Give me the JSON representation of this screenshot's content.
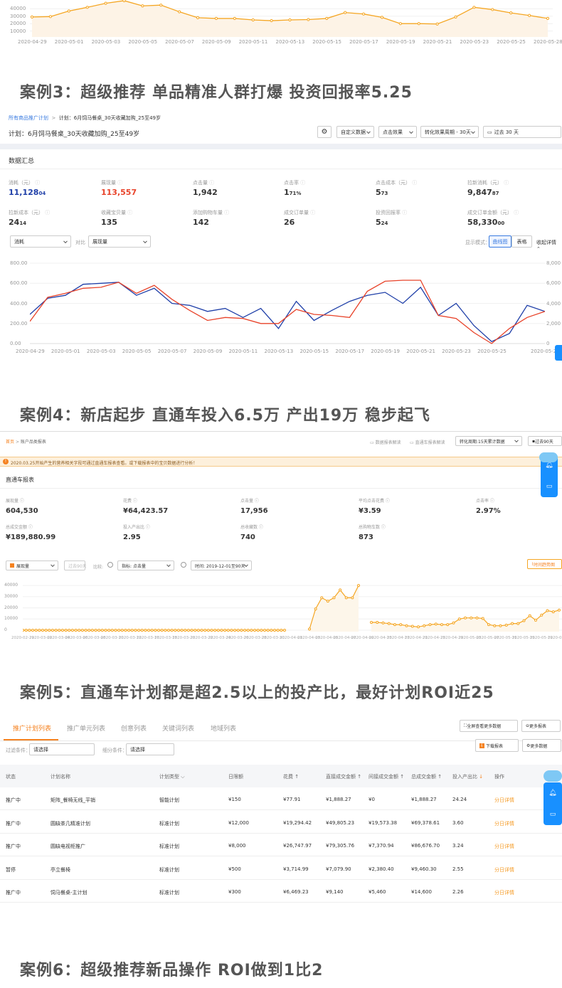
{
  "top_chart": {
    "y_ticks": [
      "40000",
      "30000",
      "20000",
      "10000"
    ],
    "x_ticks": [
      "2020-04-29",
      "2020-05-01",
      "2020-05-03",
      "2020-05-05",
      "2020-05-07",
      "2020-05-09",
      "2020-05-11",
      "2020-05-13",
      "2020-05-15",
      "2020-05-17",
      "2020-05-19",
      "2020-05-21",
      "2020-05-23",
      "2020-05-25",
      "2020-05-28"
    ],
    "series": [
      29000,
      29500,
      37000,
      42000,
      47500,
      51000,
      44000,
      45000,
      36000,
      28000,
      27000,
      27000,
      25000,
      24000,
      25000,
      25500,
      27000,
      35000,
      33000,
      28500,
      20000,
      20000,
      19500,
      29000,
      42000,
      39000,
      34500,
      31000,
      27000
    ]
  },
  "case3": {
    "title": "案例3：超级推荐 单品精准人群打爆 投资回报率5.25",
    "breadcrumb_link": "所有商品推广计划",
    "breadcrumb_current": "计划：6月饲马餐桌_30天收藏加购_25至49岁",
    "plan_title": "计划：6月饲马餐桌_30天收藏加购_25至49岁",
    "toolbar": {
      "custom_data": "自定义数据",
      "click_effect": "点击效果",
      "conversion_period": "转化效果周期 - 30天",
      "date_range": "过去 30 天"
    },
    "summary_title": "数据汇总",
    "metrics": [
      {
        "label": "消耗（元）",
        "main": "11,128",
        "dec": "04"
      },
      {
        "label": "展现量",
        "main": "113,557",
        "dec": ""
      },
      {
        "label": "点击量",
        "main": "1,942",
        "dec": ""
      },
      {
        "label": "点击率",
        "main": "1",
        "dec": "71%"
      },
      {
        "label": "点击成本（元）",
        "main": "5",
        "dec": "73"
      },
      {
        "label": "拉新消耗（元）",
        "main": "9,847",
        "dec": "87"
      },
      {
        "label": "拉新成本（元）",
        "main": "24",
        "dec": "14"
      },
      {
        "label": "收藏宝贝量",
        "main": "135",
        "dec": ""
      },
      {
        "label": "添加购物车量",
        "main": "142",
        "dec": ""
      },
      {
        "label": "成交订单量",
        "main": "26",
        "dec": ""
      },
      {
        "label": "投资回报率",
        "main": "5",
        "dec": "24"
      },
      {
        "label": "成交订单金额（元）",
        "main": "58,330",
        "dec": "00"
      }
    ],
    "select_left": "消耗",
    "compare_label": "对比",
    "select_right": "展现量",
    "display_mode_label": "显示模式：",
    "mode_curve": "曲线图",
    "mode_table": "表格",
    "collapse": "收起详情",
    "chart_data": {
      "type": "line",
      "x": [
        "2020-04-29",
        "2020-04-30",
        "2020-05-01",
        "2020-05-02",
        "2020-05-03",
        "2020-05-04",
        "2020-05-05",
        "2020-05-06",
        "2020-05-07",
        "2020-05-08",
        "2020-05-09",
        "2020-05-10",
        "2020-05-11",
        "2020-05-12",
        "2020-05-13",
        "2020-05-14",
        "2020-05-15",
        "2020-05-16",
        "2020-05-17",
        "2020-05-18",
        "2020-05-19",
        "2020-05-20",
        "2020-05-21",
        "2020-05-22",
        "2020-05-23",
        "2020-05-24",
        "2020-05-25",
        "2020-05-26",
        "2020-05-27",
        "2020-05-28"
      ],
      "x_ticks": [
        "2020-04-29",
        "2020-05-01",
        "2020-05-03",
        "2020-05-05",
        "2020-05-07",
        "2020-05-09",
        "2020-05-11",
        "2020-05-13",
        "2020-05-15",
        "2020-05-17",
        "2020-05-19",
        "2020-05-21",
        "2020-05-23",
        "2020-05-25",
        "2020-05-28"
      ],
      "y_left_ticks": [
        "800.00",
        "600.00",
        "400.00",
        "200.00",
        "0.00"
      ],
      "y_right_ticks": [
        "8,000",
        "6,000",
        "4,000",
        "2,000",
        "0"
      ],
      "ylim": [
        0,
        800
      ],
      "series": [
        {
          "name": "消耗",
          "color": "#1f3fa8",
          "values": [
            290,
            450,
            480,
            590,
            600,
            610,
            480,
            550,
            400,
            380,
            320,
            350,
            260,
            350,
            150,
            420,
            230,
            330,
            420,
            480,
            510,
            400,
            560,
            280,
            400,
            180,
            20,
            100,
            380,
            320
          ]
        },
        {
          "name": "展现量",
          "color": "#e8432a",
          "values": [
            220,
            460,
            500,
            550,
            560,
            610,
            500,
            580,
            440,
            330,
            230,
            260,
            250,
            200,
            200,
            340,
            290,
            280,
            260,
            520,
            620,
            630,
            630,
            280,
            250,
            110,
            0,
            150,
            260,
            320
          ]
        }
      ]
    }
  },
  "case4": {
    "title": "案例4：新店起步 直通车投入6.5万 产出19万 稳步起飞",
    "breadcrumb_home": "首页",
    "breadcrumb_current": "账户品类报表",
    "top_links": [
      "数据报表解读",
      "直通车报表解读"
    ],
    "conversion_select": "转化周期:15天累计数据",
    "date_btn": "过去90天",
    "notice": "2020.03.25开始产生的营养相关字段可通过直通车报表查看。或下载报表中的宝贝数据进行分析！",
    "report_title": "直通车报表",
    "metrics": [
      {
        "label": "展现量",
        "value": "604,530"
      },
      {
        "label": "花费",
        "value": "¥64,423.57"
      },
      {
        "label": "点击量",
        "value": "17,956"
      },
      {
        "label": "平均点击花费",
        "value": "¥3.59"
      },
      {
        "label": "点击率",
        "value": "2.97%"
      },
      {
        "label": "总成交金额",
        "value": "¥189,880.99"
      },
      {
        "label": "投入产出比",
        "value": "2.95"
      },
      {
        "label": "总收藏数",
        "value": "740"
      },
      {
        "label": "总购物车数",
        "value": "873"
      }
    ],
    "select_metric": "展现量",
    "past_btn": "过去90天",
    "compare_label": "比较:",
    "index_label": "指标:",
    "index_value": "点击量",
    "time_label": "时间:",
    "time_value": "2019-12-01至90天",
    "trend_btn": "时间趋势图",
    "chart_data": {
      "type": "line",
      "y_ticks": [
        "40000",
        "30000",
        "20000",
        "10000",
        "0"
      ],
      "x_ticks": [
        "2020-02-29",
        "2020-03-02",
        "2020-03-04",
        "2020-03-06",
        "2020-03-08",
        "2020-03-10",
        "2020-03-12",
        "2020-03-16",
        "2020-03-18",
        "2020-03-20",
        "2020-03-22",
        "2020-03-24",
        "2020-03-26",
        "2020-03-28",
        "2020-03-30",
        "2020-04-01",
        "2020-04-03",
        "2020-04-05",
        "2020-04-07",
        "2020-04-09",
        "2020-04-13",
        "2020-04-17",
        "2020-04-21",
        "2020-04-25",
        "2020-04-29",
        "2020-05-03",
        "2020-05-07",
        "2020-05-11",
        "2020-05-15",
        "2020-05-19",
        "2020-05-21"
      ],
      "color": "#f5a623",
      "segment1": [
        0,
        0,
        0,
        0,
        0,
        0,
        0,
        0,
        0,
        0,
        0,
        0,
        0,
        0,
        0,
        0,
        0,
        0,
        0,
        0,
        0,
        0,
        0,
        0,
        0,
        0,
        0,
        0,
        0,
        0,
        0,
        0,
        0,
        0,
        0,
        0,
        0,
        0,
        0,
        0,
        0,
        0,
        0,
        0,
        0,
        0,
        0,
        0,
        0,
        0,
        0,
        0,
        0,
        0,
        0,
        0,
        0,
        0,
        0,
        0,
        0,
        0,
        0,
        0,
        0,
        0,
        0,
        0,
        0,
        0,
        0,
        0,
        0,
        0,
        0,
        0,
        0,
        0,
        0,
        0
      ],
      "segment2": [
        1000,
        19000,
        29000,
        26000,
        29000,
        36000,
        29000,
        29000,
        40000
      ],
      "segment3": [
        7000,
        7000,
        6500,
        6000,
        5000,
        5000,
        4000,
        3500,
        3000,
        4000,
        5000,
        5500,
        5000,
        5000,
        6500,
        10000,
        11000,
        11000,
        11000,
        10500,
        5000,
        4000,
        4000,
        4500,
        6000,
        6000,
        8500,
        13000,
        9000,
        13500,
        17500,
        16500,
        18000
      ]
    }
  },
  "case5": {
    "title": "案例5：直通车计划都是超2.5以上的投产比，最好计划ROI近25",
    "tabs": [
      "推广计划列表",
      "推广单元列表",
      "创意列表",
      "关键词列表",
      "地域列表"
    ],
    "fullscreen_btn": "全屏查看更多数据",
    "more_btn": "更多报表",
    "filter_label": "过滤条件：",
    "filter_placeholder": "请选择",
    "sub_filter_label": "细分条件：",
    "sub_filter_placeholder": "请选择",
    "download_btn": "下载报表",
    "more_data_btn": "更多数据",
    "headers": [
      "状态",
      "计划名称",
      "计划类型",
      "日限额",
      "花费",
      "直接成交金额",
      "间接成交金额",
      "总成交金额",
      "投入产出比",
      "操作"
    ],
    "rows": [
      [
        "推广中",
        "矩阵_餐椅无线_平销",
        "智能计划",
        "¥150",
        "¥77.91",
        "¥1,888.27",
        "¥0",
        "¥1,888.27",
        "24.24",
        "分日详情"
      ],
      [
        "推广中",
        "圆缺茶几精准计划",
        "标准计划",
        "¥12,000",
        "¥19,294.42",
        "¥49,805.23",
        "¥19,573.38",
        "¥69,378.61",
        "3.60",
        "分日详情"
      ],
      [
        "推广中",
        "圆缺电视柜推广",
        "标准计划",
        "¥8,000",
        "¥26,747.97",
        "¥79,305.76",
        "¥7,370.94",
        "¥86,676.70",
        "3.24",
        "分日详情"
      ],
      [
        "暂停",
        "亭立餐椅",
        "标准计划",
        "¥500",
        "¥3,714.99",
        "¥7,079.90",
        "¥2,380.40",
        "¥9,460.30",
        "2.55",
        "分日详情"
      ],
      [
        "推广中",
        "饲马餐桌-主计划",
        "标准计划",
        "¥300",
        "¥6,469.23",
        "¥9,140",
        "¥5,460",
        "¥14,600",
        "2.26",
        "分日详情"
      ]
    ]
  },
  "case6": {
    "title": "案例6：超级推荐新品操作 ROI做到1比2"
  }
}
